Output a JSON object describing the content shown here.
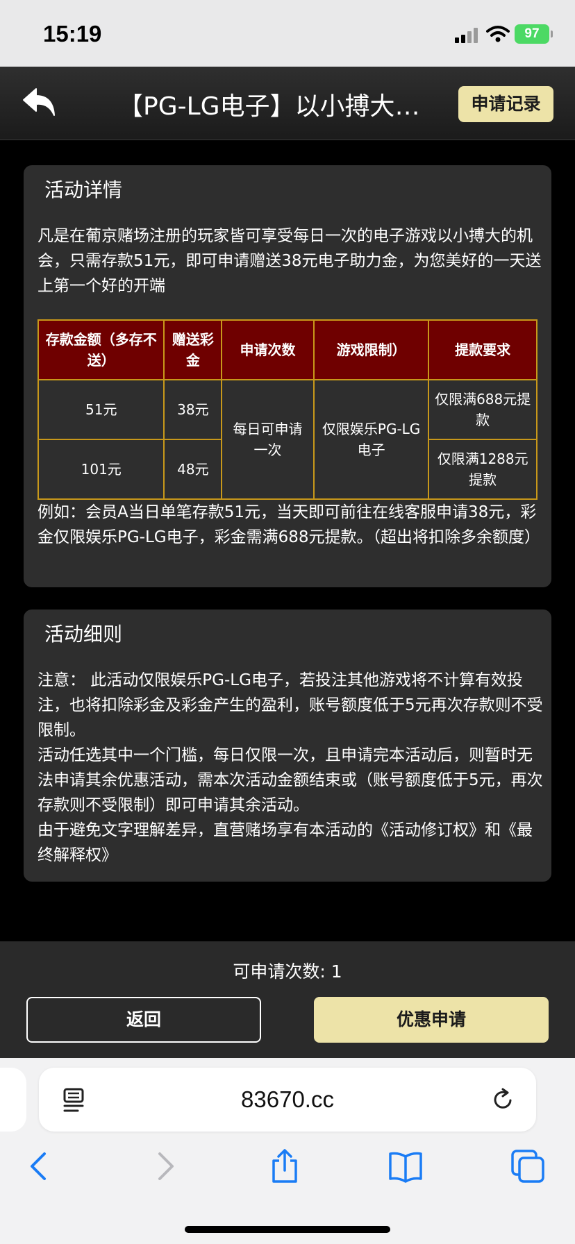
{
  "status_bar": {
    "time": "15:19",
    "battery": "97"
  },
  "header": {
    "title": "【PG-LG电子】以小搏大助力金",
    "records_label": "申请记录"
  },
  "details": {
    "title": "活动详情",
    "intro": "凡是在葡京赌场注册的玩家皆可享受每日一次的电子游戏以小搏大的机会，只需存款51元，即可申请赠送38元电子助力金，为您美好的一天送上第一个好的开端",
    "table": {
      "headers": [
        "存款金额（多存不送）",
        "赠送彩金",
        "申请次数",
        "游戏限制）",
        "提款要求"
      ],
      "rows": [
        {
          "deposit": "51元",
          "bonus": "38元",
          "withdraw": "仅限满688元提款"
        },
        {
          "deposit": "101元",
          "bonus": "48元",
          "withdraw": "仅限满1288元提款"
        }
      ],
      "times": "每日可申请一次",
      "game": "仅限娱乐PG-LG电子"
    },
    "example": "例如：会员A当日单笔存款51元，当天即可前往在线客服申请38元，彩金仅限娱乐PG-LG电子，彩金需满688元提款。（超出将扣除多余额度）"
  },
  "rules": {
    "title": "活动细则",
    "p1": "注意： 此活动仅限娱乐PG-LG电子，若投注其他游戏将不计算有效投注，也将扣除彩金及彩金产生的盈利，账号额度低于5元再次存款则不受限制。",
    "p2": "活动任选其中一个门槛，每日仅限一次，且申请完本活动后，则暂时无法申请其余优惠活动，需本次活动金额结束或（账号额度低于5元，再次存款则不受限制）即可申请其余活动。",
    "p3": "由于避免文字理解差异，直营赌场享有本活动的《活动修订权》和《最终解释权》"
  },
  "footer": {
    "count_label": "可申请次数: ",
    "count_value": "1",
    "back_label": "返回",
    "apply_label": "优惠申请"
  },
  "browser": {
    "url": "83670.cc"
  },
  "colors": {
    "accent": "#ede3a8",
    "table_header": "#6f0000",
    "table_border": "#c8981a",
    "card": "#2e2e2e"
  }
}
